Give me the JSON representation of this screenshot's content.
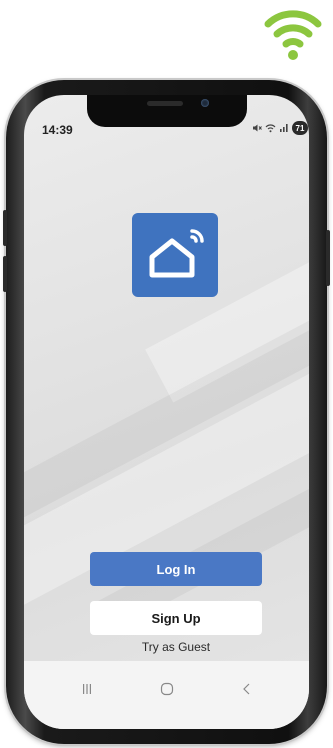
{
  "status_bar": {
    "time": "14:39",
    "icons": [
      "mute-icon",
      "wifi-icon",
      "signal-icon"
    ],
    "battery_level": "71"
  },
  "app": {
    "logo_icon": "smart-home-icon",
    "brand_color": "#3f73bf"
  },
  "actions": {
    "login_label": "Log In",
    "signup_label": "Sign Up",
    "guest_label": "Try as Guest"
  },
  "nav_bar": {
    "buttons": [
      "recents-icon",
      "home-icon",
      "back-icon"
    ]
  },
  "colors": {
    "wifi_badge": "#8cc63f",
    "login_button": "#4a78c5",
    "signup_button": "#ffffff"
  }
}
